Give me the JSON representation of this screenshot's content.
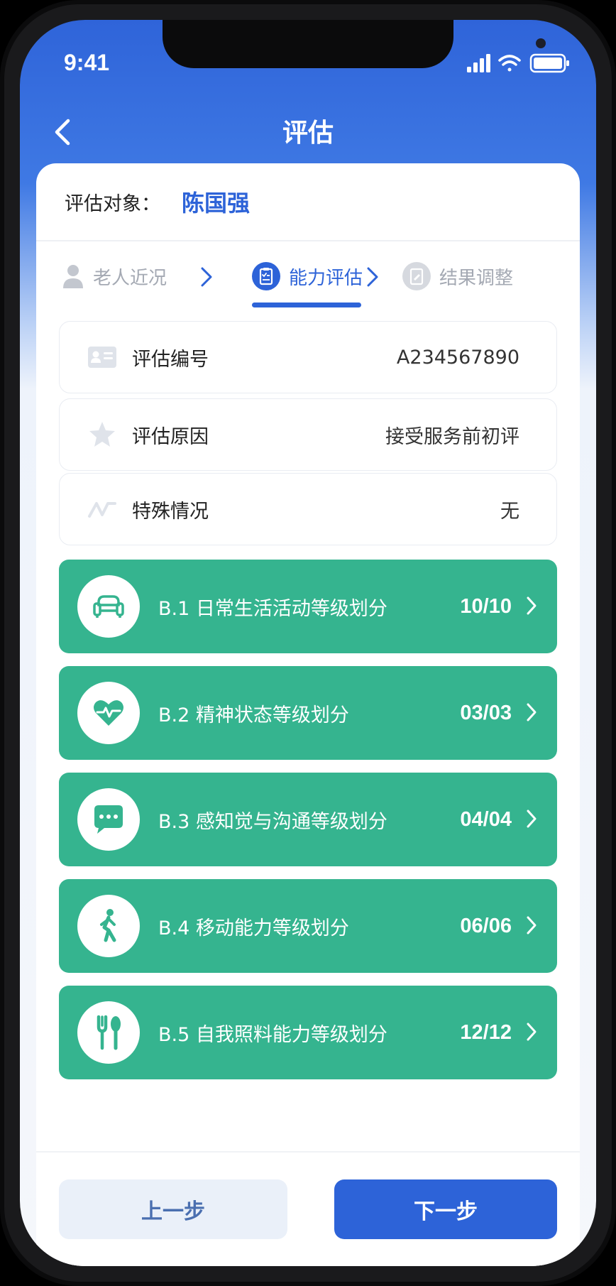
{
  "status": {
    "time": "9:41"
  },
  "nav": {
    "title": "评估"
  },
  "subject": {
    "label": "评估对象：",
    "name": "陈国强"
  },
  "steps": [
    {
      "label": "老人近况",
      "icon": "person-icon"
    },
    {
      "label": "能力评估",
      "icon": "clipboard-icon"
    },
    {
      "label": "结果调整",
      "icon": "edit-icon"
    }
  ],
  "info": [
    {
      "label": "评估编号",
      "value": "A234567890",
      "icon": "id-card-icon"
    },
    {
      "label": "评估原因",
      "value": "接受服务前初评",
      "icon": "star-icon"
    },
    {
      "label": "特殊情况",
      "value": "无",
      "icon": "trend-icon"
    }
  ],
  "items": [
    {
      "title": "B.1 日常生活活动等级划分",
      "count": "10/10",
      "icon": "sofa-icon"
    },
    {
      "title": "B.2 精神状态等级划分",
      "count": "03/03",
      "icon": "heart-pulse-icon"
    },
    {
      "title": "B.3 感知觉与沟通等级划分",
      "count": "04/04",
      "icon": "chat-icon"
    },
    {
      "title": "B.4 移动能力等级划分",
      "count": "06/06",
      "icon": "walking-icon"
    },
    {
      "title": "B.5 自我照料能力等级划分",
      "count": "12/12",
      "icon": "utensils-icon"
    }
  ],
  "buttons": {
    "prev": "上一步",
    "next": "下一步"
  },
  "colors": {
    "primary": "#2d63d8",
    "item_green": "#35b48f",
    "inactive_gray": "#a4a9b3"
  }
}
